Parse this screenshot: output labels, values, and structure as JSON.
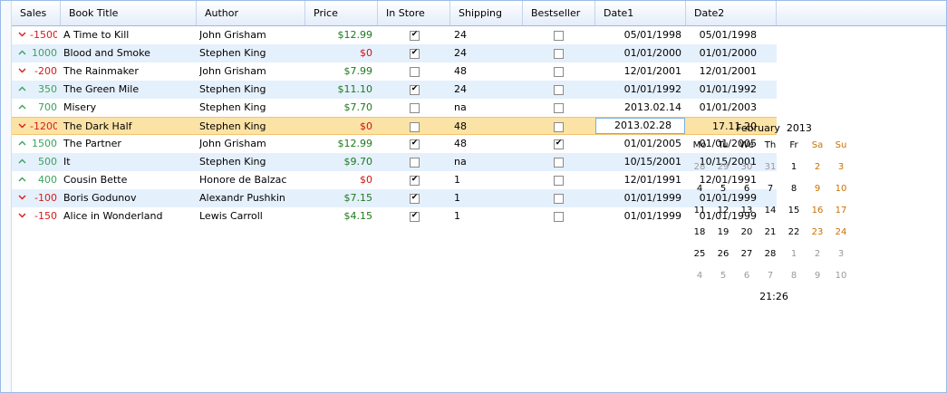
{
  "columns": [
    "Sales",
    "Book Title",
    "Author",
    "Price",
    "In Store",
    "Shipping",
    "Bestseller",
    "Date1",
    "Date2"
  ],
  "rows": [
    {
      "trend": "down",
      "sales": "-1500",
      "title": "A Time to Kill",
      "author": "John Grisham",
      "price": "$12.99",
      "price_sign": "pos",
      "instore": true,
      "shipping": "24",
      "bestseller": false,
      "date1": "05/01/1998",
      "date2": "05/01/1998"
    },
    {
      "trend": "up",
      "sales": "1000",
      "title": "Blood and Smoke",
      "author": "Stephen King",
      "price": "$0",
      "price_sign": "neg",
      "instore": true,
      "shipping": "24",
      "bestseller": false,
      "date1": "01/01/2000",
      "date2": "01/01/2000"
    },
    {
      "trend": "down",
      "sales": "-200",
      "title": "The Rainmaker",
      "author": "John Grisham",
      "price": "$7.99",
      "price_sign": "pos",
      "instore": false,
      "shipping": "48",
      "bestseller": false,
      "date1": "12/01/2001",
      "date2": "12/01/2001"
    },
    {
      "trend": "up",
      "sales": "350",
      "title": "The Green Mile",
      "author": "Stephen King",
      "price": "$11.10",
      "price_sign": "pos",
      "instore": true,
      "shipping": "24",
      "bestseller": false,
      "date1": "01/01/1992",
      "date2": "01/01/1992"
    },
    {
      "trend": "up",
      "sales": "700",
      "title": "Misery",
      "author": "Stephen King",
      "price": "$7.70",
      "price_sign": "pos",
      "instore": false,
      "shipping": "na",
      "bestseller": false,
      "date1": "2013.02.14",
      "date2": "01/01/2003"
    },
    {
      "trend": "down",
      "sales": "-1200",
      "title": "The Dark Half",
      "author": "Stephen King",
      "price": "$0",
      "price_sign": "neg",
      "instore": false,
      "shipping": "48",
      "bestseller": false,
      "date1": "2013.02.28",
      "date2": "17.11.20"
    },
    {
      "trend": "up",
      "sales": "1500",
      "title": "The Partner",
      "author": "John Grisham",
      "price": "$12.99",
      "price_sign": "pos",
      "instore": true,
      "shipping": "48",
      "bestseller": true,
      "date1": "01/01/2005",
      "date2": "01/01/2005"
    },
    {
      "trend": "up",
      "sales": "500",
      "title": "It",
      "author": "Stephen King",
      "price": "$9.70",
      "price_sign": "pos",
      "instore": false,
      "shipping": "na",
      "bestseller": false,
      "date1": "10/15/2001",
      "date2": "10/15/2001"
    },
    {
      "trend": "up",
      "sales": "400",
      "title": "Cousin Bette",
      "author": "Honore de Balzac",
      "price": "$0",
      "price_sign": "neg",
      "instore": true,
      "shipping": "1",
      "bestseller": false,
      "date1": "12/01/1991",
      "date2": "12/01/1991"
    },
    {
      "trend": "down",
      "sales": "-100",
      "title": "Boris Godunov",
      "author": "Alexandr Pushkin",
      "price": "$7.15",
      "price_sign": "pos",
      "instore": true,
      "shipping": "1",
      "bestseller": false,
      "date1": "01/01/1999",
      "date2": "01/01/1999"
    },
    {
      "trend": "down",
      "sales": "-150",
      "title": "Alice in Wonderland",
      "author": "Lewis Carroll",
      "price": "$4.15",
      "price_sign": "pos",
      "instore": true,
      "shipping": "1",
      "bestseller": false,
      "date1": "01/01/1999",
      "date2": "01/01/1999"
    }
  ],
  "selected_row": 5,
  "editor": {
    "value": "2013.02.28"
  },
  "calendar": {
    "month": "February",
    "year": "2013",
    "weekdays": [
      "Mo",
      "Tu",
      "We",
      "Th",
      "Fr",
      "Sa",
      "Su"
    ],
    "weeks": [
      [
        {
          "d": "28",
          "o": true
        },
        {
          "d": "29",
          "o": true
        },
        {
          "d": "30",
          "o": true
        },
        {
          "d": "31",
          "o": true
        },
        {
          "d": "1"
        },
        {
          "d": "2"
        },
        {
          "d": "3"
        }
      ],
      [
        {
          "d": "4"
        },
        {
          "d": "5"
        },
        {
          "d": "6"
        },
        {
          "d": "7"
        },
        {
          "d": "8"
        },
        {
          "d": "9"
        },
        {
          "d": "10"
        }
      ],
      [
        {
          "d": "11"
        },
        {
          "d": "12"
        },
        {
          "d": "13"
        },
        {
          "d": "14"
        },
        {
          "d": "15"
        },
        {
          "d": "16"
        },
        {
          "d": "17"
        }
      ],
      [
        {
          "d": "18"
        },
        {
          "d": "19"
        },
        {
          "d": "20"
        },
        {
          "d": "21"
        },
        {
          "d": "22"
        },
        {
          "d": "23"
        },
        {
          "d": "24"
        }
      ],
      [
        {
          "d": "25"
        },
        {
          "d": "26"
        },
        {
          "d": "27"
        },
        {
          "d": "28"
        },
        {
          "d": "1",
          "o": true
        },
        {
          "d": "2",
          "o": true
        },
        {
          "d": "3",
          "o": true
        }
      ],
      [
        {
          "d": "4",
          "o": true
        },
        {
          "d": "5",
          "o": true
        },
        {
          "d": "6",
          "o": true
        },
        {
          "d": "7",
          "o": true
        },
        {
          "d": "8",
          "o": true
        },
        {
          "d": "9",
          "o": true
        },
        {
          "d": "10",
          "o": true
        }
      ]
    ],
    "time": "21:26"
  },
  "colors": {
    "header_border": "#99bbe8",
    "alt_row": "#e5f0fd",
    "selected_row": "#fbe3a6",
    "up": "#3aa35c",
    "down": "#d81a1a",
    "weekend": "#c97100"
  },
  "icons": {
    "up": "chevron-up-icon",
    "down": "chevron-down-icon"
  }
}
